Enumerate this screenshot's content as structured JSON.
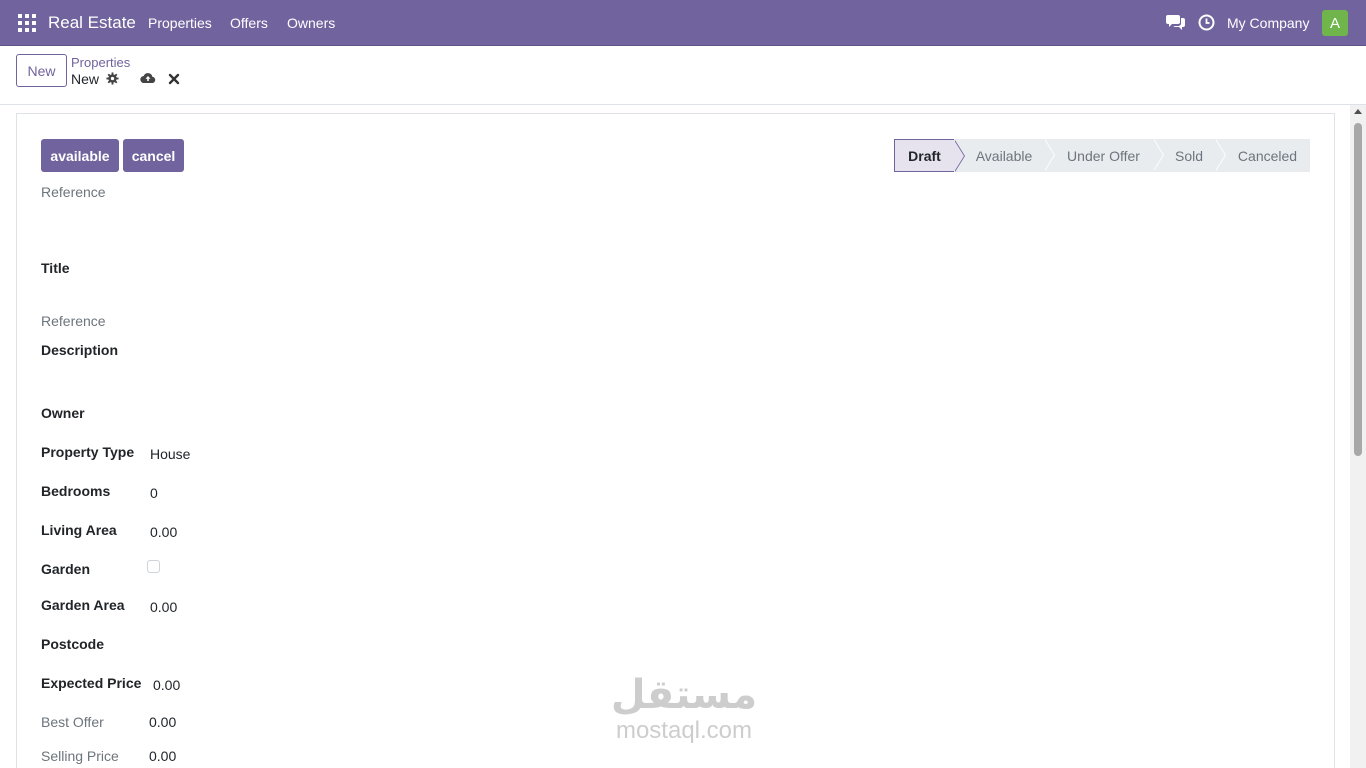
{
  "navbar": {
    "brand": "Real Estate",
    "menu": [
      "Properties",
      "Offers",
      "Owners"
    ],
    "company": "My Company",
    "avatar_letter": "A",
    "icons": [
      "apps-icon",
      "chat-icon",
      "clock-icon"
    ]
  },
  "control": {
    "new_label": "New",
    "breadcrumb_parent": "Properties",
    "breadcrumb_current": "New",
    "icons": [
      "gear-icon",
      "cloud-upload-icon",
      "close-icon"
    ]
  },
  "header_buttons": {
    "available": "available",
    "cancel": "cancel"
  },
  "status_stages": [
    "Draft",
    "Available",
    "Under Offer",
    "Sold",
    "Canceled"
  ],
  "active_stage": "Draft",
  "form": {
    "reference_top": "Reference",
    "title": "Title",
    "reference_label": "Reference",
    "description": "Description",
    "owner": "Owner",
    "property_type_label": "Property Type",
    "property_type_value": "House",
    "bedrooms_label": "Bedrooms",
    "bedrooms_value": "0",
    "living_area_label": "Living Area",
    "living_area_value": "0.00",
    "garden_label": "Garden",
    "garden_checked": false,
    "garden_area_label": "Garden Area",
    "garden_area_value": "0.00",
    "postcode_label": "Postcode",
    "expected_price_label": "Expected Price",
    "expected_price_value": "0.00",
    "best_offer_label": "Best Offer",
    "best_offer_value": "0.00",
    "selling_price_label": "Selling Price",
    "selling_price_value": "0.00"
  },
  "watermark": {
    "arabic": "مستقل",
    "latin": "mostaql.com"
  },
  "colors": {
    "brand": "#71639e",
    "avatar": "#6fb54b"
  }
}
